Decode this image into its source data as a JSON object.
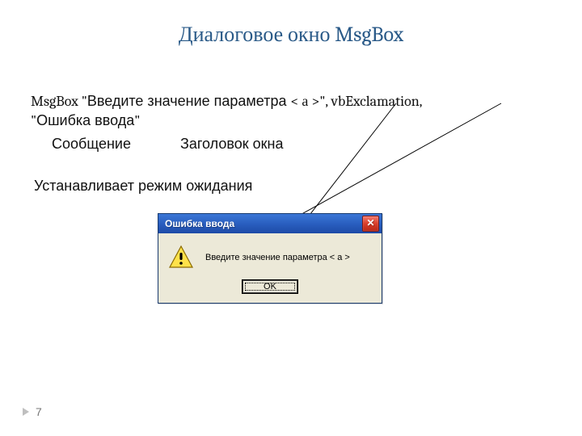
{
  "title": "Диалоговое окно MsgBox",
  "code": {
    "fn": "MsgBox",
    "open_quote": " \"",
    "msg_text": "Введите значение параметра ",
    "param": "< а >",
    "after_param": "\",  ",
    "flag": "vbExclamation",
    "sep": ", ",
    "title_open": "\"",
    "title_text": "Ошибка ввода",
    "title_close": "\""
  },
  "labels": {
    "message": "Сообщение",
    "window_title": "Заголовок окна"
  },
  "subtitle": "Устанавливает режим ожидания",
  "msgbox": {
    "title": "Ошибка ввода",
    "close": "✕",
    "text": "Введите значение параметра < a >",
    "ok": "OK"
  },
  "page_number": "7"
}
